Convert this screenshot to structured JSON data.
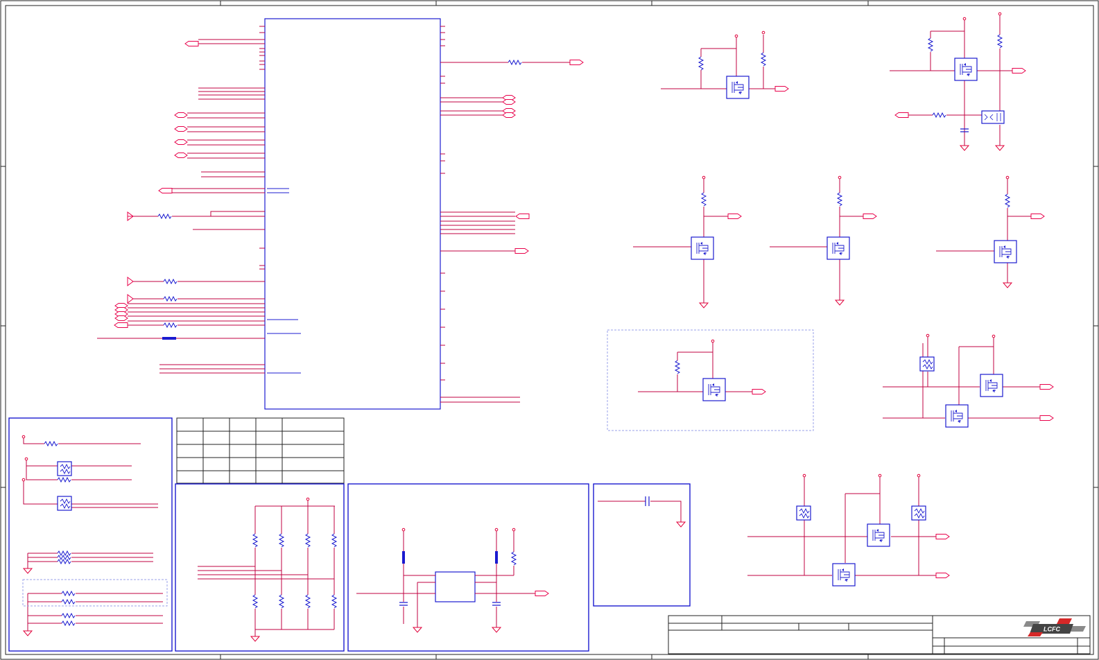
{
  "title_block": {
    "logo_text": "LCFC",
    "cells": [
      "",
      "",
      "",
      "",
      "",
      "",
      ""
    ]
  },
  "option_table": {
    "columns": 5,
    "rows": 4
  },
  "colors": {
    "wire": "#c00040",
    "net_port": "#e8004a",
    "frame": "#1b1bd0",
    "component": "#1a1acf",
    "power_symbol": "#e0003a",
    "option_box": "#9aa0e8",
    "border": "#222222",
    "logo_bg": "#d62828",
    "logo_text": "#ffffff"
  },
  "icons": {
    "port": "net-port-arrow",
    "ground": "ground-symbol",
    "resistor": "resistor-zigzag",
    "mosfet": "mosfet-box",
    "fuse": "ptc-fuse-box",
    "capacitor": "capacitor-plates"
  }
}
